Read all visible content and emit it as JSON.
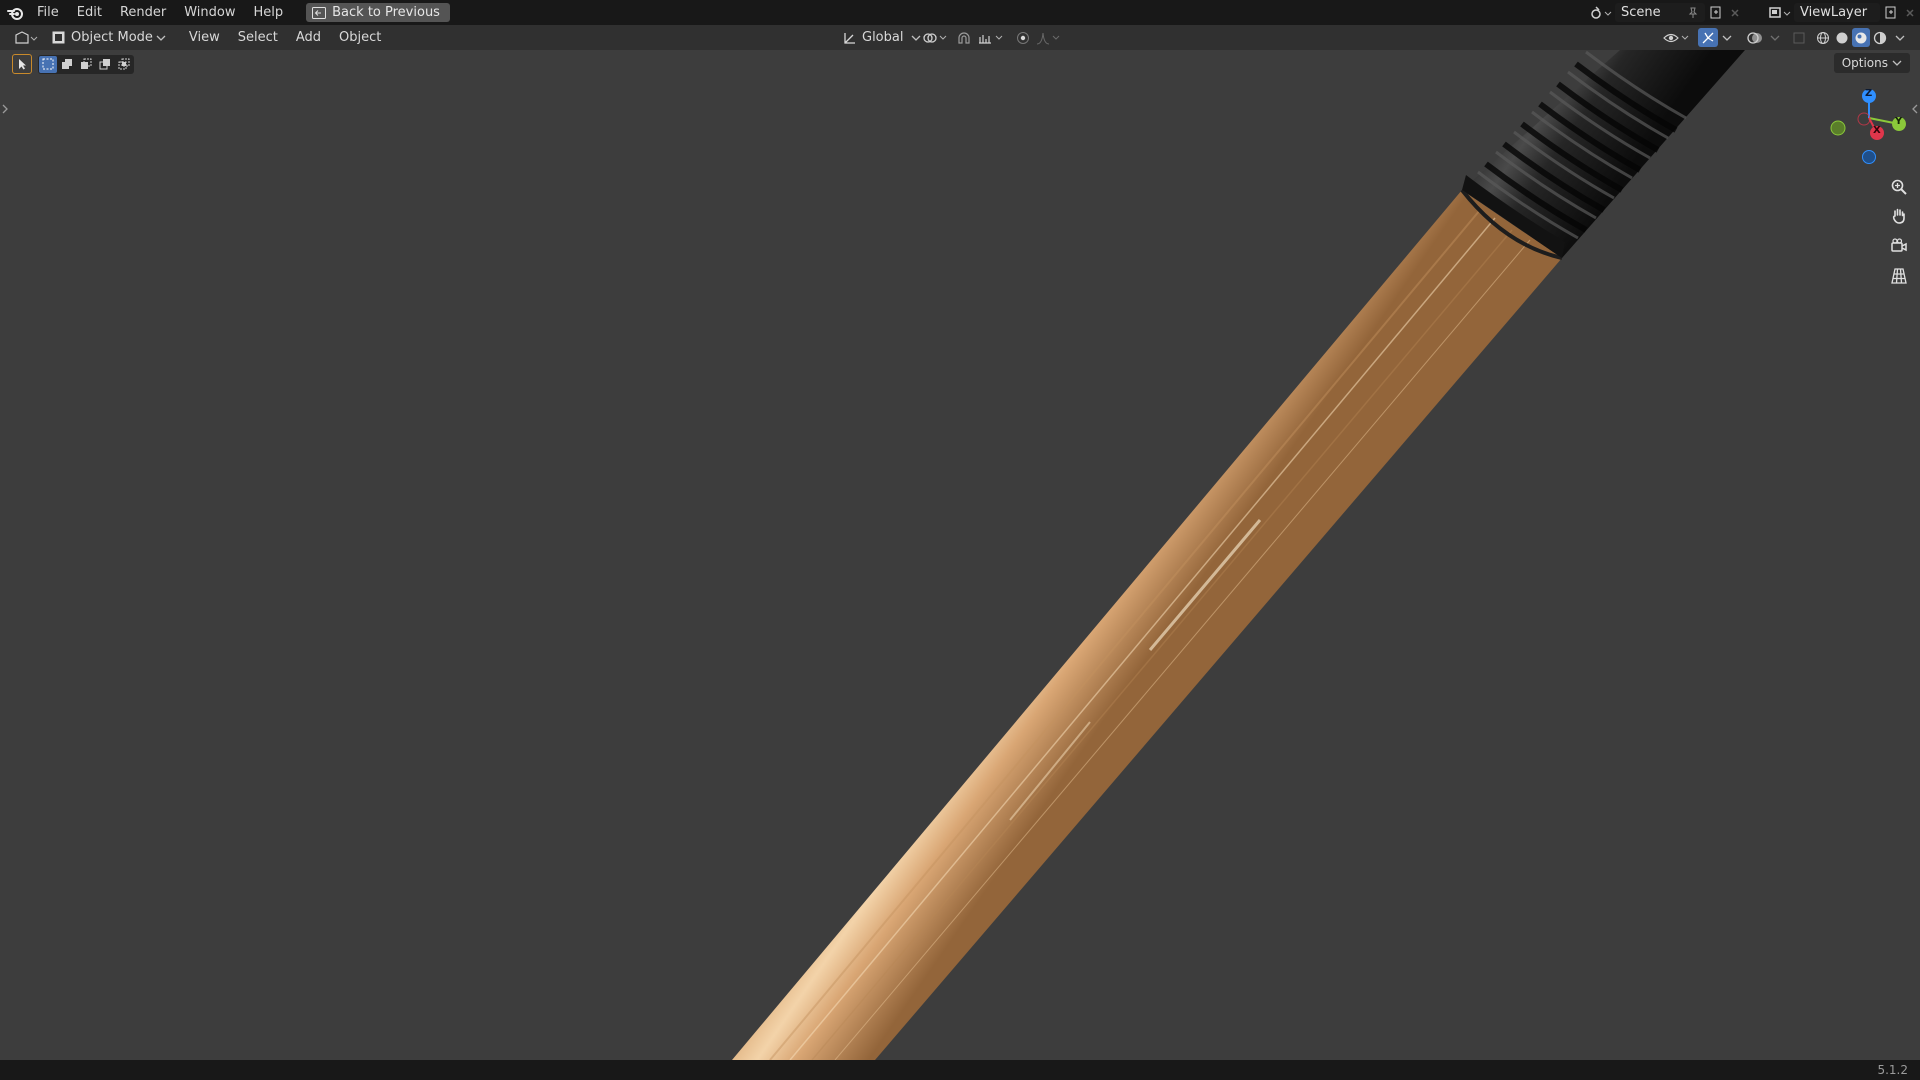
{
  "menu": {
    "items": [
      "File",
      "Edit",
      "Render",
      "Window",
      "Help"
    ],
    "back_button": "Back to Previous"
  },
  "scene": {
    "label": "Scene"
  },
  "view_layer": {
    "label": "ViewLayer"
  },
  "header": {
    "object_mode": "Object Mode",
    "menus": [
      "View",
      "Select",
      "Add",
      "Object"
    ],
    "transform_orientation": "Global"
  },
  "viewport": {
    "options_label": "Options",
    "gizmo": {
      "z": "Z",
      "y": "Y",
      "x": "X"
    }
  },
  "status": {
    "version": "5.1.2"
  },
  "colors": {
    "accent": "#4772b3",
    "axis_x": "#e0364b",
    "axis_y": "#8bc93a",
    "axis_z": "#2f8fff",
    "viewport_bg": "#3d3d3d"
  }
}
